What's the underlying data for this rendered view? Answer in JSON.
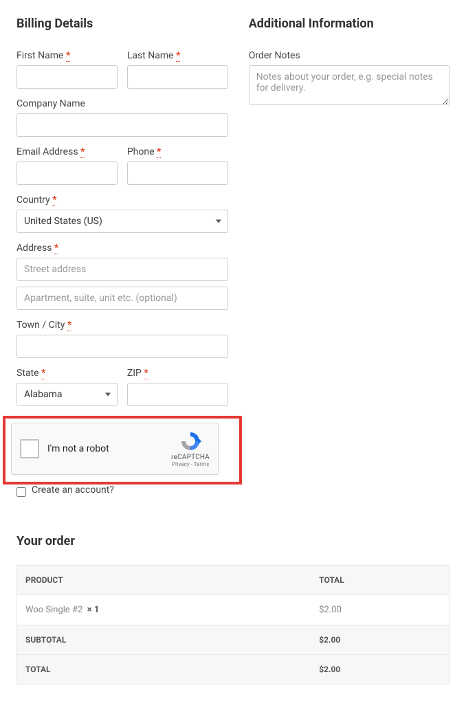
{
  "billing": {
    "heading": "Billing Details",
    "first_name_label": "First Name",
    "last_name_label": "Last Name",
    "company_label": "Company Name",
    "email_label": "Email Address",
    "phone_label": "Phone",
    "country_label": "Country",
    "country_value": "United States (US)",
    "address_label": "Address",
    "address_placeholder_1": "Street address",
    "address_placeholder_2": "Apartment, suite, unit etc. (optional)",
    "town_label": "Town / City",
    "state_label": "State",
    "state_value": "Alabama",
    "zip_label": "ZIP",
    "required_mark": "*"
  },
  "recaptcha": {
    "label": "I'm not a robot",
    "brand": "reCAPTCHA",
    "links": "Privacy - Terms"
  },
  "create_account_label": "Create an account?",
  "additional": {
    "heading": "Additional Information",
    "notes_label": "Order Notes",
    "notes_placeholder": "Notes about your order, e.g. special notes for delivery."
  },
  "order": {
    "heading": "Your order",
    "col_product": "PRODUCT",
    "col_total": "TOTAL",
    "items": [
      {
        "name": "Woo Single #2",
        "qty": "× 1",
        "total": "$2.00"
      }
    ],
    "subtotal_label": "SUBTOTAL",
    "subtotal_value": "$2.00",
    "total_label": "TOTAL",
    "total_value": "$2.00"
  }
}
